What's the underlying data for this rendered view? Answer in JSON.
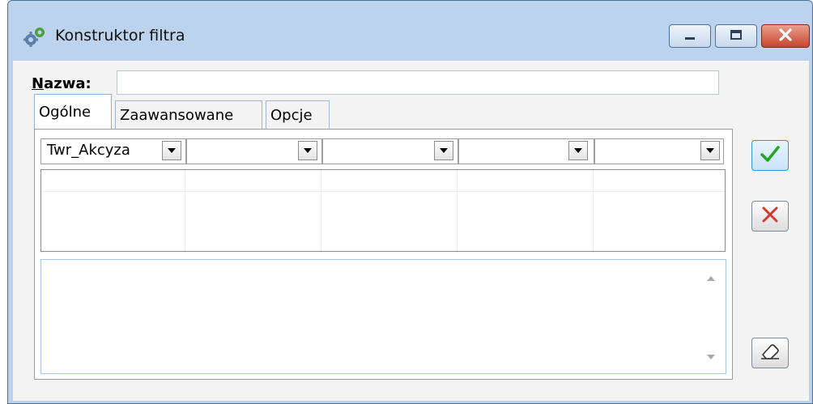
{
  "window": {
    "title": "Konstruktor filtra",
    "icon": "gear-filter-icon"
  },
  "form": {
    "name_label_underlined": "N",
    "name_label_rest": "azwa:",
    "name_value": ""
  },
  "tabs": [
    {
      "label": "Ogólne",
      "active": true
    },
    {
      "label": "Zaawansowane",
      "active": false
    },
    {
      "label": "Opcje",
      "active": false
    }
  ],
  "selects": [
    "Twr_Akcyza",
    "",
    "",
    "",
    ""
  ],
  "memo": {
    "value": ""
  },
  "buttons": {
    "ok": "check-icon",
    "cancel": "x-icon",
    "clear": "eraser-icon"
  },
  "colors": {
    "ok": "#2aa32a",
    "cancel": "#d33a2f",
    "close_button": "#c8452e"
  }
}
